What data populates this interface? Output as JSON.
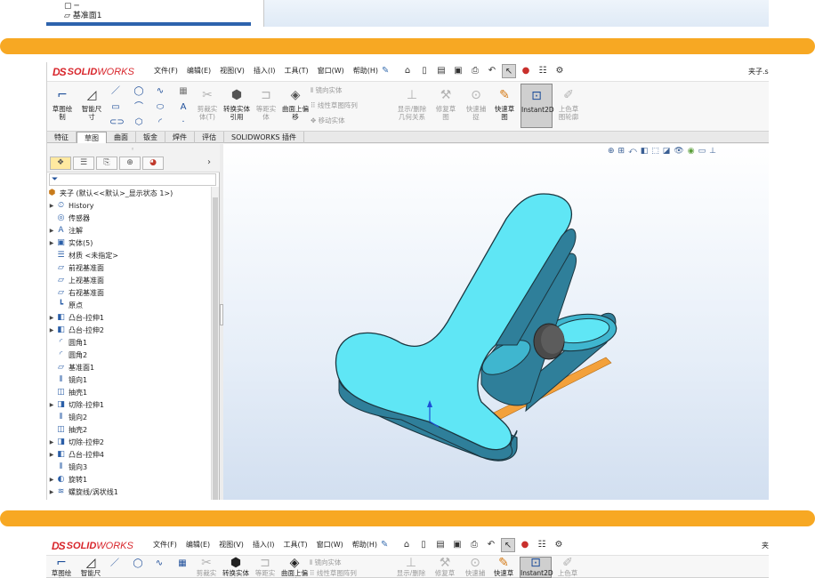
{
  "top_panel": {
    "tree_row_label": "基准面1"
  },
  "app": {
    "logo_prefix": "DS",
    "logo_solid": "SOLID",
    "logo_works": "WORKS",
    "menu": [
      "文件(F)",
      "编辑(E)",
      "视图(V)",
      "插入(I)",
      "工具(T)",
      "窗口(W)",
      "帮助(H)"
    ],
    "document_title": "夹子.s",
    "document_title_short": "夹"
  },
  "ribbon": {
    "buttons": [
      {
        "id": "sketch",
        "label": "草图绘制"
      },
      {
        "id": "smart-dim",
        "label": "智能尺寸"
      },
      {
        "id": "trim",
        "label": "剪裁实体(T)"
      },
      {
        "id": "convert",
        "label": "转换实体引用"
      },
      {
        "id": "offset-entities",
        "label": "等距实体"
      },
      {
        "id": "offset-surface",
        "label": "曲面上偏移"
      },
      {
        "id": "show-relations",
        "label": "显示/删除几何关系"
      },
      {
        "id": "repair",
        "label": "修复草图"
      },
      {
        "id": "quick-snap",
        "label": "快速捕捉"
      },
      {
        "id": "rapid-sketch",
        "label": "快速草图"
      },
      {
        "id": "instant2d",
        "label": "Instant2D"
      },
      {
        "id": "shaded-contour",
        "label": "上色草图轮廓"
      }
    ],
    "mirror": "镜向实体",
    "linear_pattern": "线性草图阵列",
    "move": "移动实体"
  },
  "tabs": [
    "特征",
    "草图",
    "曲面",
    "钣金",
    "焊件",
    "评估",
    "SOLIDWORKS 插件"
  ],
  "active_tab": "草图",
  "tree": {
    "root": "夹子 (默认<<默认>_显示状态 1>)",
    "items": [
      {
        "label": "History",
        "icon": "history-icon",
        "exp": true
      },
      {
        "label": "传感器",
        "icon": "sensor-icon",
        "exp": false
      },
      {
        "label": "注解",
        "icon": "annotation-icon",
        "exp": true
      },
      {
        "label": "实体(5)",
        "icon": "solid-bodies-icon",
        "exp": true
      },
      {
        "label": "材质 <未指定>",
        "icon": "material-icon",
        "exp": false
      },
      {
        "label": "前视基准面",
        "icon": "plane-icon",
        "exp": false
      },
      {
        "label": "上视基准面",
        "icon": "plane-icon",
        "exp": false
      },
      {
        "label": "右视基准面",
        "icon": "plane-icon",
        "exp": false
      },
      {
        "label": "原点",
        "icon": "origin-icon",
        "exp": false
      },
      {
        "label": "凸台-拉伸1",
        "icon": "extrude-icon",
        "exp": true
      },
      {
        "label": "凸台-拉伸2",
        "icon": "extrude-icon",
        "exp": true
      },
      {
        "label": "圆角1",
        "icon": "fillet-icon",
        "exp": false
      },
      {
        "label": "圆角2",
        "icon": "fillet-icon",
        "exp": false
      },
      {
        "label": "基准面1",
        "icon": "plane-icon",
        "exp": false
      },
      {
        "label": "镜向1",
        "icon": "mirror-icon",
        "exp": false
      },
      {
        "label": "抽壳1",
        "icon": "shell-icon",
        "exp": false
      },
      {
        "label": "切除-拉伸1",
        "icon": "cut-icon",
        "exp": true
      },
      {
        "label": "镜向2",
        "icon": "mirror-icon",
        "exp": false
      },
      {
        "label": "抽壳2",
        "icon": "shell-icon",
        "exp": false
      },
      {
        "label": "切除-拉伸2",
        "icon": "cut-icon",
        "exp": true
      },
      {
        "label": "凸台-拉伸4",
        "icon": "extrude-icon",
        "exp": true
      },
      {
        "label": "镜向3",
        "icon": "mirror-icon",
        "exp": false
      },
      {
        "label": "旋转1",
        "icon": "revolve-icon",
        "exp": true
      },
      {
        "label": "螺旋线/涡状线1",
        "icon": "helix-icon",
        "exp": true
      }
    ]
  },
  "colors": {
    "accent_bar": "#f7a823",
    "model_face": "#5fe6f5",
    "model_side": "#2f7f9a",
    "model_edge": "#1b3640",
    "spring_orange": "#f3a13b",
    "pivot": "#4a4a4a"
  }
}
